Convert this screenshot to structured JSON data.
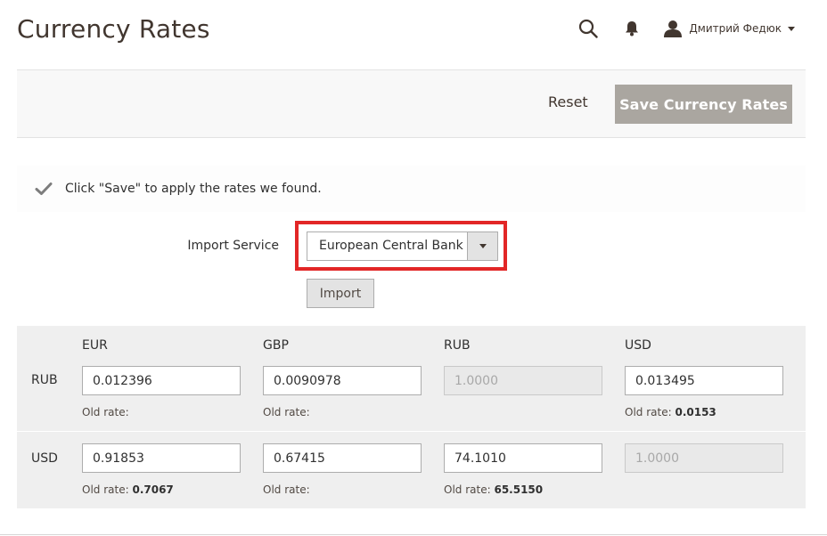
{
  "header": {
    "title": "Currency Rates",
    "user_name": "Дмитрий Федюк",
    "icons": {
      "search": "search-icon",
      "notifications": "bell-icon",
      "user": "user-icon"
    }
  },
  "actions": {
    "reset_label": "Reset",
    "save_label": "Save Currency Rates"
  },
  "message": {
    "text": "Click \"Save\" to apply the rates we found.",
    "icon": "check-icon"
  },
  "import": {
    "label": "Import Service",
    "selected_service": "European Central Bank",
    "button_label": "Import"
  },
  "rates": {
    "columns": [
      "EUR",
      "GBP",
      "RUB",
      "USD"
    ],
    "old_rate_label": "Old rate:",
    "rows": [
      {
        "label": "RUB",
        "values": [
          "0.012396",
          "0.0090978",
          "1.0000",
          "0.013495"
        ],
        "old_rates": [
          "",
          "",
          null,
          "0.0153"
        ]
      },
      {
        "label": "USD",
        "values": [
          "0.91853",
          "0.67415",
          "74.1010",
          "1.0000"
        ],
        "old_rates": [
          "0.7067",
          "",
          "65.5150",
          null
        ]
      }
    ]
  },
  "colors": {
    "accent_red": "#e22626",
    "save_button": "#aaa6a0",
    "table_bg": "#efefef"
  }
}
